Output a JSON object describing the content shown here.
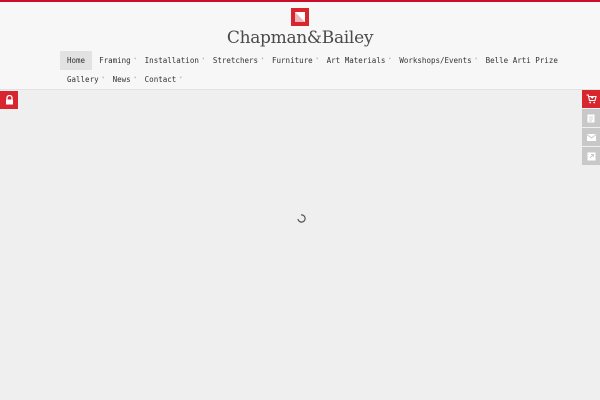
{
  "brand": {
    "name": "Chapman&Bailey"
  },
  "nav": {
    "row1": [
      {
        "label": "Home",
        "active": true
      },
      {
        "label": "Framing"
      },
      {
        "label": "Installation"
      },
      {
        "label": "Stretchers"
      },
      {
        "label": "Furniture"
      },
      {
        "label": "Art Materials"
      },
      {
        "label": "Workshops/Events"
      },
      {
        "label": "Belle Arti Prize"
      }
    ],
    "row2": [
      {
        "label": "Gallery"
      },
      {
        "label": "News"
      },
      {
        "label": "Contact"
      }
    ]
  },
  "icons": {
    "lock": "lock-icon",
    "cart": "cart-icon",
    "tool2": "document-icon",
    "tool3": "mail-icon",
    "tool4": "external-link-icon",
    "loading": "loading-spinner-icon"
  },
  "colors": {
    "accent": "#d8262f",
    "background": "#efefef",
    "header": "#f7f7f7",
    "tool_gray": "#c8c8c8"
  }
}
